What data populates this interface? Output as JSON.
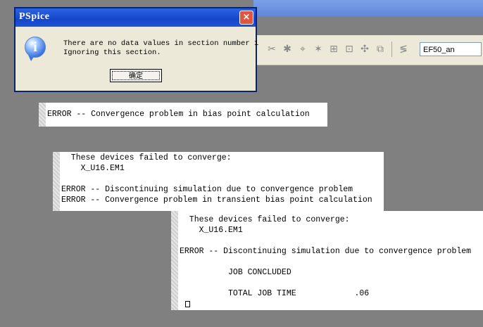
{
  "dialog": {
    "title": "PSpice",
    "close_glyph": "×",
    "icon": "information-icon",
    "message_line1": "There are no data values in section number 1",
    "message_line2": "Ignoring this section.",
    "ok_label": "确定"
  },
  "toolbar": {
    "icons": [
      "toolbar-icon-1",
      "toolbar-icon-2",
      "toolbar-icon-3",
      "toolbar-icon-4",
      "toolbar-icon-5",
      "toolbar-icon-6",
      "toolbar-icon-7",
      "toolbar-icon-8"
    ],
    "combo_value": "EF50_an"
  },
  "output": {
    "panel1": [
      "ERROR -- Convergence problem in bias point calculation"
    ],
    "panel2": [
      "  These devices failed to converge:",
      "    X_U16.EM1",
      "",
      "ERROR -- Discontinuing simulation due to convergence problem",
      "ERROR -- Convergence problem in transient bias point calculation"
    ],
    "panel3": [
      "  These devices failed to converge:",
      "    X_U16.EM1",
      "",
      "ERROR -- Discontinuing simulation due to convergence problem",
      "",
      "          JOB CONCLUDED",
      "",
      "          TOTAL JOB TIME            .06"
    ]
  },
  "colors": {
    "desktop": "#808080",
    "dialog_title": "#1646c8",
    "close_button": "#e0553d"
  }
}
